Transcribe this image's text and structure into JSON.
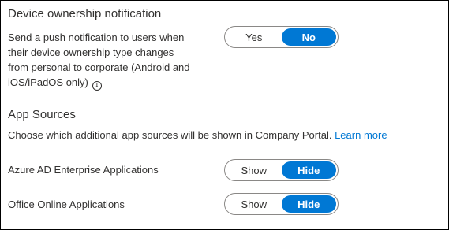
{
  "ownership": {
    "title": "Device ownership notification",
    "lines": [
      "Send a push notification to users when",
      "their device ownership type changes",
      "from personal to corporate (Android and",
      "iOS/iPadOS only)"
    ],
    "info_icon": "info-icon",
    "toggle": {
      "option_a": "Yes",
      "option_b": "No",
      "selected": "No"
    }
  },
  "app_sources": {
    "title": "App Sources",
    "description": "Choose which additional app sources will be shown in Company Portal.",
    "link": "Learn more",
    "rows": [
      {
        "label": "Azure AD Enterprise Applications",
        "option_a": "Show",
        "option_b": "Hide",
        "selected": "Hide"
      },
      {
        "label": "Office Online Applications",
        "option_a": "Show",
        "option_b": "Hide",
        "selected": "Hide"
      }
    ]
  },
  "colors": {
    "accent": "#0078d4",
    "text": "#323130",
    "border": "#8a8886"
  }
}
